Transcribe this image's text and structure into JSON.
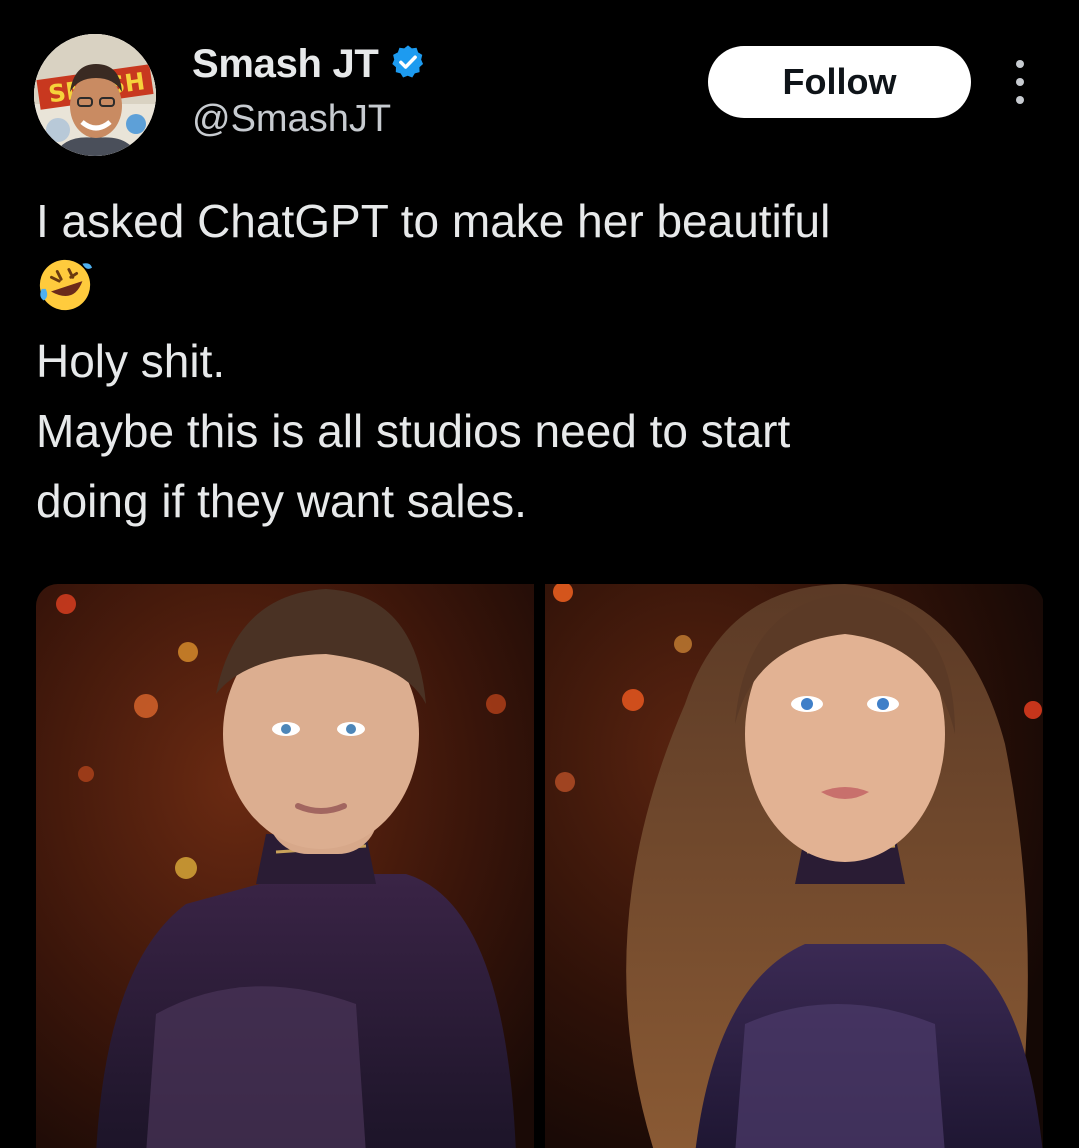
{
  "post": {
    "author": {
      "display_name": "Smash JT",
      "handle": "@SmashJT",
      "verified_icon": "verified-badge-icon",
      "avatar_icon": "avatar-photo",
      "avatar_sign_text": "SMASH"
    },
    "follow_label": "Follow",
    "more_icon": "more-options-icon",
    "text": {
      "line1": "I asked ChatGPT to make her beautiful",
      "emoji": "rolling-on-the-floor-laughing-emoji",
      "line2": "Holy shit.",
      "line3": "Maybe this is all studios need to start",
      "line4": "doing if they want sales."
    },
    "media": [
      {
        "icon": "superhero-portrait-before"
      },
      {
        "icon": "superhero-portrait-after"
      }
    ]
  },
  "colors": {
    "background": "#000000",
    "text": "#e7e9ea",
    "secondary_text": "#c7cbd0",
    "verified": "#1d9bf0",
    "follow_bg": "#ffffff",
    "follow_text": "#0f1419"
  }
}
